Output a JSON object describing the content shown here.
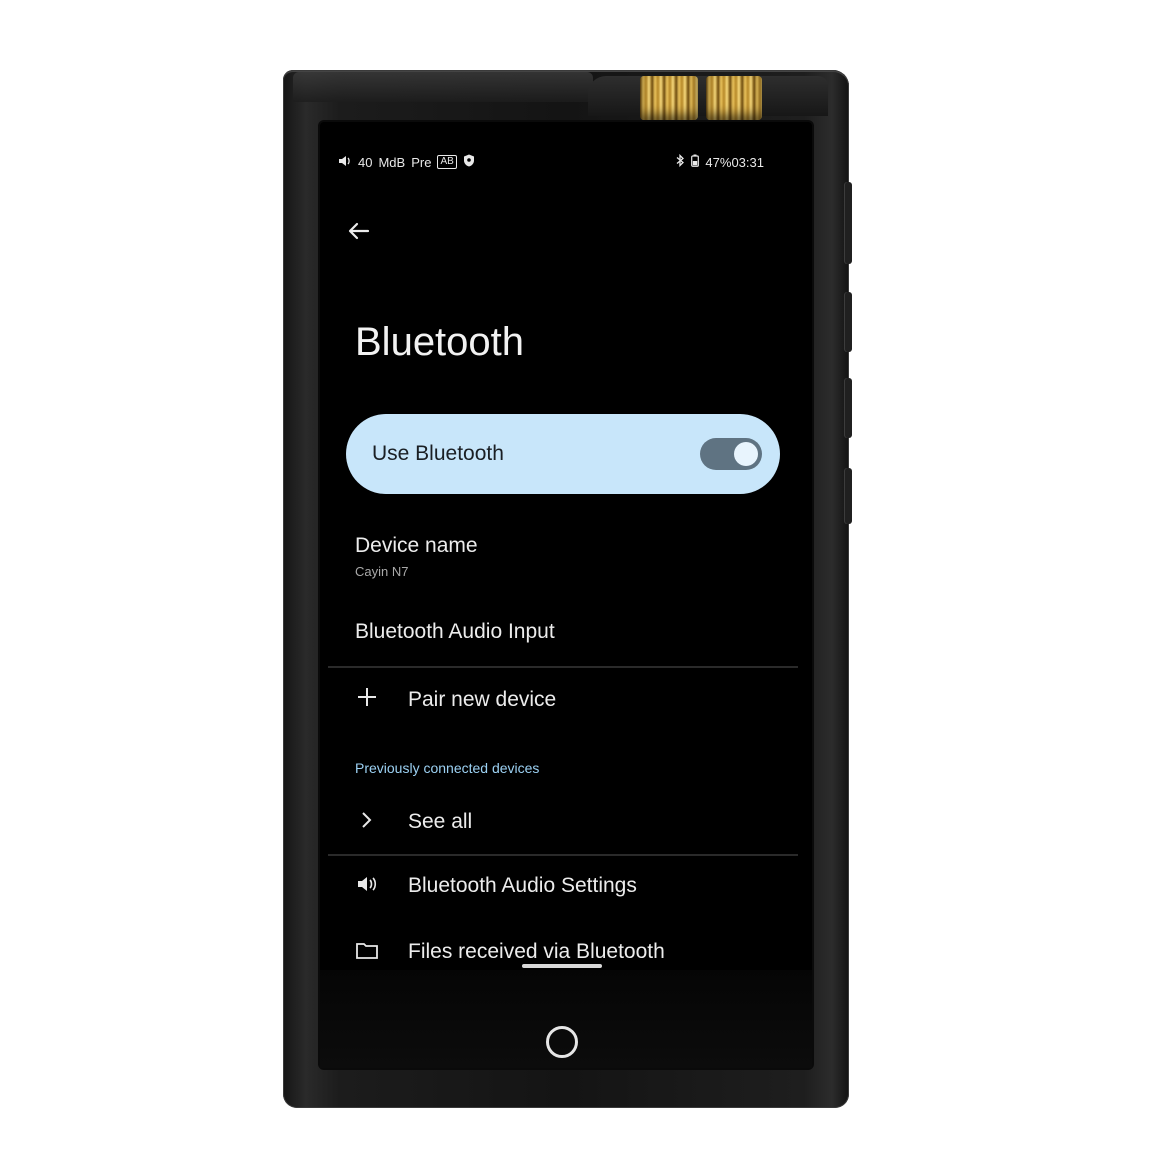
{
  "status_bar": {
    "volume_icon": "speaker-icon",
    "volume_value": "40",
    "gain_label": "MdB",
    "mode_label": "Pre",
    "ab_badge": "AB",
    "shield_icon": "shield-icon",
    "bluetooth_icon": "bluetooth-icon",
    "battery_icon": "battery-icon",
    "battery_percent": "47%",
    "time": "03:31"
  },
  "header": {
    "back_icon": "arrow-left-icon",
    "title": "Bluetooth"
  },
  "use_bluetooth": {
    "label": "Use Bluetooth",
    "enabled": true,
    "accent_color": "#c8e6fa"
  },
  "device_name": {
    "title": "Device name",
    "value": "Cayin N7"
  },
  "audio_input": {
    "title": "Bluetooth Audio Input"
  },
  "pair_new": {
    "icon": "plus-icon",
    "label": "Pair new device"
  },
  "previously_connected": {
    "header": "Previously connected devices",
    "header_color": "#9cd1f3"
  },
  "see_all": {
    "icon": "chevron-right-icon",
    "label": "See all"
  },
  "audio_settings": {
    "icon": "speaker-icon",
    "label": "Bluetooth Audio Settings"
  },
  "files_received": {
    "icon": "folder-icon",
    "label": "Files received via Bluetooth"
  },
  "navigation": {
    "home_icon": "home-circle-icon"
  }
}
